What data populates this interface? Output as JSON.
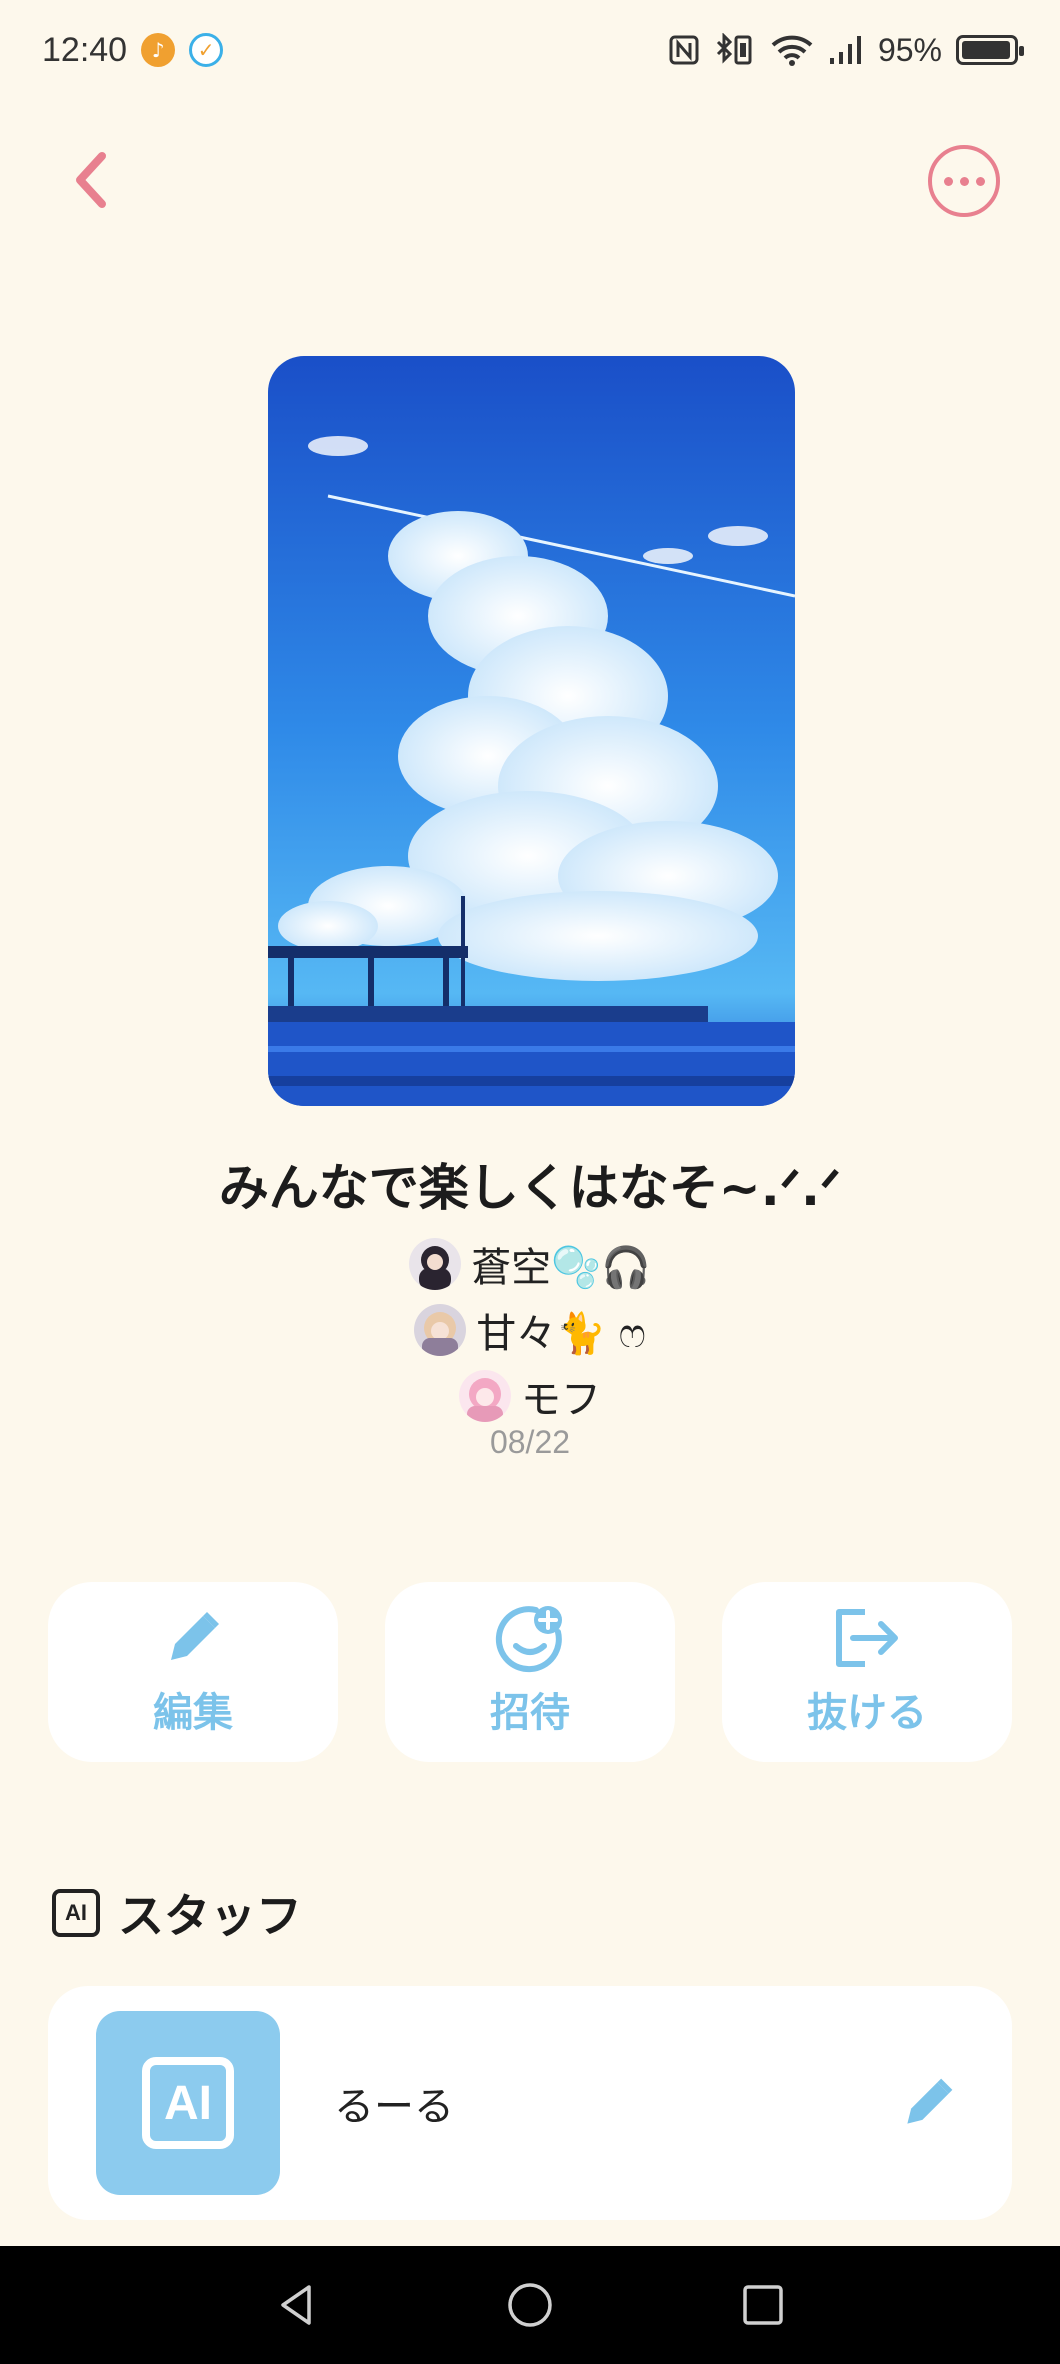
{
  "status_bar": {
    "time": "12:40",
    "battery": "95%",
    "battery_level": 0.95
  },
  "header": {
    "back_icon": "chevron-left-icon",
    "more_icon": "more-horizontal-icon",
    "accent_color": "#e8808f"
  },
  "room": {
    "title": "みんなで楽しくはなそ~.ᐟ.ᐟ",
    "members": [
      {
        "name": "蒼空🫧🎧"
      },
      {
        "name": "甘々🐈 ෆ"
      },
      {
        "name": "モフ"
      }
    ],
    "date": "08/22"
  },
  "actions": [
    {
      "label": "編集",
      "icon": "pencil-icon"
    },
    {
      "label": "招待",
      "icon": "add-friend-icon"
    },
    {
      "label": "抜ける",
      "icon": "exit-icon"
    }
  ],
  "staff": {
    "heading": "スタッフ",
    "badge": "AI",
    "items": [
      {
        "name": "るーる",
        "avatar_text": "AI"
      }
    ]
  },
  "colors": {
    "background": "#fdf8ec",
    "action_blue": "#7cc3ea",
    "staff_avatar": "#8ccbee"
  }
}
